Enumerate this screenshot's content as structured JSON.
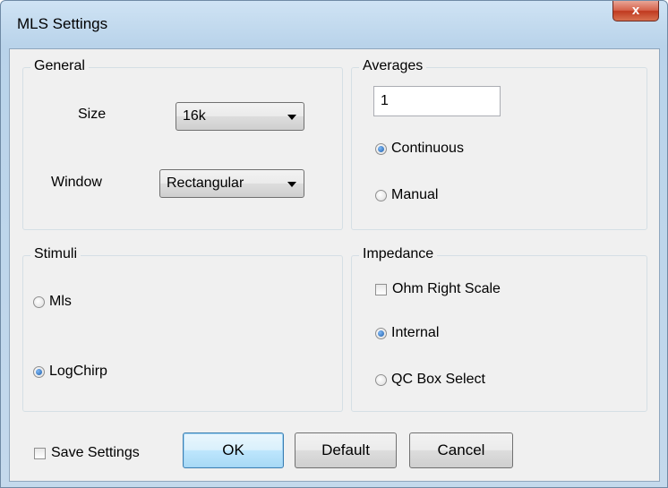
{
  "window": {
    "title": "MLS Settings",
    "close_glyph": "x"
  },
  "general": {
    "label": "General",
    "size_label": "Size",
    "size_value": "16k",
    "window_label": "Window",
    "window_value": "Rectangular"
  },
  "averages": {
    "label": "Averages",
    "count_value": "1",
    "continuous_label": "Continuous",
    "manual_label": "Manual",
    "selected": "Continuous"
  },
  "stimuli": {
    "label": "Stimuli",
    "mls_label": "Mls",
    "logchirp_label": "LogChirp",
    "selected": "LogChirp"
  },
  "impedance": {
    "label": "Impedance",
    "ohm_right_scale_label": "Ohm Right Scale",
    "ohm_right_scale_checked": false,
    "internal_label": "Internal",
    "qc_box_label": "QC Box Select",
    "selected": "Internal"
  },
  "footer": {
    "save_settings_label": "Save Settings",
    "save_settings_checked": false,
    "ok_label": "OK",
    "default_label": "Default",
    "cancel_label": "Cancel"
  },
  "colors": {
    "accent": "#3c7fb1",
    "radio_selected": "#1f5fab",
    "close_button": "#c0391f"
  }
}
